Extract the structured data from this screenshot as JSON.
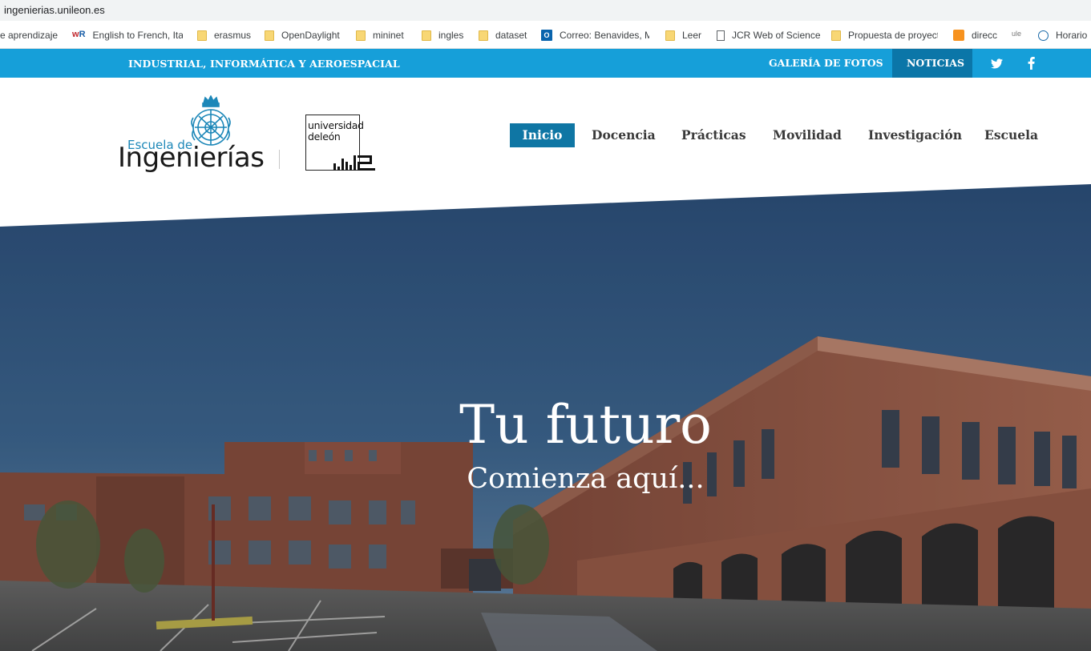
{
  "browser": {
    "url": "ingenierias.unileon.es",
    "bookmarks": [
      {
        "label": "e aprendizaje",
        "icon": "page-icon"
      },
      {
        "label": "English to French, Ital",
        "icon": "wordreference-icon"
      },
      {
        "label": "erasmus",
        "icon": "folder-icon"
      },
      {
        "label": "OpenDaylight",
        "icon": "folder-icon"
      },
      {
        "label": "mininet",
        "icon": "folder-icon"
      },
      {
        "label": "ingles",
        "icon": "folder-icon"
      },
      {
        "label": "dataset",
        "icon": "folder-icon"
      },
      {
        "label": "Correo: Benavides, M",
        "icon": "outlook-icon"
      },
      {
        "label": "Leer",
        "icon": "folder-icon"
      },
      {
        "label": "JCR Web of Science",
        "icon": "page-icon"
      },
      {
        "label": "Propuesta de proyect",
        "icon": "folder-icon"
      },
      {
        "label": "direcc",
        "icon": "chart-icon"
      },
      {
        "label": "ule",
        "icon": "ule-icon"
      },
      {
        "label": "Horario",
        "icon": "globe-icon"
      }
    ]
  },
  "topbar": {
    "tagline": "INDUSTRIAL, INFORMÁTICA Y AEROESPACIAL",
    "gallery": "GALERÍA DE FOTOS",
    "news": "NOTICIAS",
    "social": [
      "twitter-icon",
      "facebook-icon"
    ],
    "bg_color": "#169fd9",
    "active_color": "#0b76a8"
  },
  "header": {
    "logo_small": "Escuela de",
    "logo_big": "Ingenierías",
    "ule_line1": "universidad",
    "ule_line2": "deleón",
    "nav": [
      {
        "label": "Inicio",
        "active": true
      },
      {
        "label": "Docencia",
        "active": false
      },
      {
        "label": "Prácticas",
        "active": false
      },
      {
        "label": "Movilidad",
        "active": false
      },
      {
        "label": "Investigación",
        "active": false
      },
      {
        "label": "Escuela",
        "active": false
      }
    ],
    "accent": "#0f76a4"
  },
  "hero": {
    "title": "Tu futuro",
    "subtitle": "Comienza aquí..."
  }
}
